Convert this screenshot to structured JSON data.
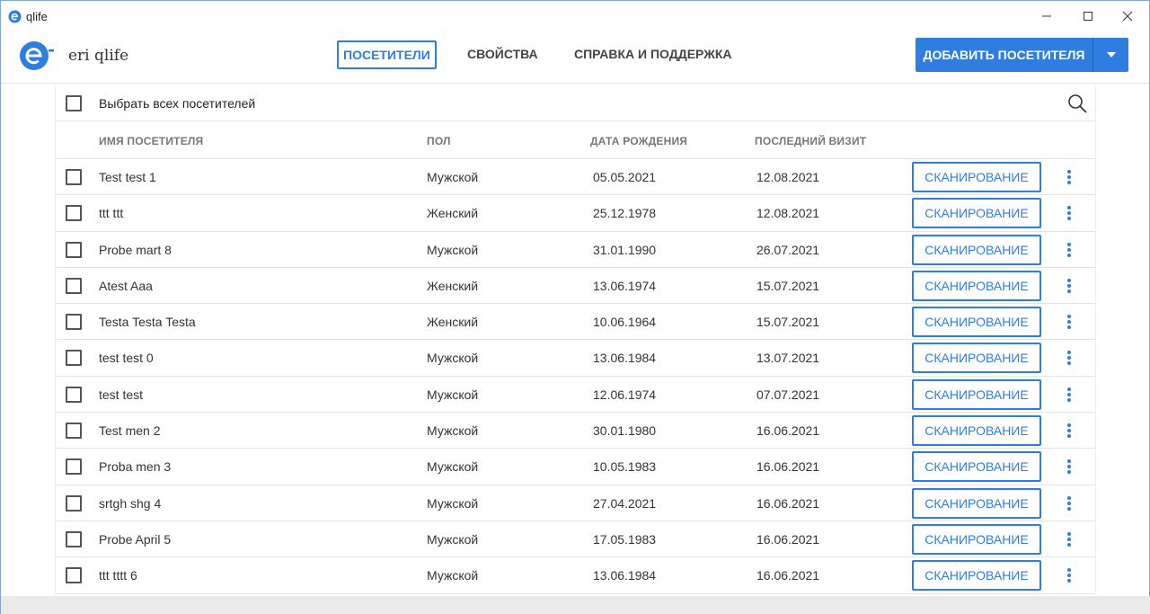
{
  "window": {
    "title": "qlife",
    "minimize_icon": "minimize-icon",
    "maximize_icon": "maximize-icon",
    "close_icon": "close-icon"
  },
  "header": {
    "brand": "eri qlife",
    "tabs": [
      {
        "label": "ПОСЕТИТЕЛИ",
        "active": true
      },
      {
        "label": "СВОЙСТВА",
        "active": false
      },
      {
        "label": "СПРАВКА И ПОДДЕРЖКА",
        "active": false
      }
    ],
    "add_button": "ДОБАВИТЬ ПОСЕТИТЕЛЯ"
  },
  "colors": {
    "accent": "#2d7ee0",
    "text": "#333333",
    "header_text": "#777777"
  },
  "table": {
    "select_all_label": "Выбрать всех посетителей",
    "columns": [
      "ИМЯ ПОСЕТИТЕЛЯ",
      "ПОЛ",
      "ДАТА РОЖДЕНИЯ",
      "ПОСЛЕДНИЙ ВИЗИТ"
    ],
    "scan_label": "СКАНИРОВАНИЕ",
    "rows": [
      {
        "name": "Test test 1",
        "sex": "Мужской",
        "dob": "05.05.2021",
        "last": "12.08.2021"
      },
      {
        "name": "ttt ttt",
        "sex": "Женский",
        "dob": "25.12.1978",
        "last": "12.08.2021"
      },
      {
        "name": "Probe mart 8",
        "sex": "Мужской",
        "dob": "31.01.1990",
        "last": "26.07.2021"
      },
      {
        "name": "Atest Aaa",
        "sex": "Женский",
        "dob": "13.06.1974",
        "last": "15.07.2021"
      },
      {
        "name": "Testa Testa Testa",
        "sex": "Женский",
        "dob": "10.06.1964",
        "last": "15.07.2021"
      },
      {
        "name": "test test 0",
        "sex": "Мужской",
        "dob": "13.06.1984",
        "last": "13.07.2021"
      },
      {
        "name": "test test",
        "sex": "Мужской",
        "dob": "12.06.1974",
        "last": "07.07.2021"
      },
      {
        "name": "Test men 2",
        "sex": "Мужской",
        "dob": "30.01.1980",
        "last": "16.06.2021"
      },
      {
        "name": "Proba men 3",
        "sex": "Мужской",
        "dob": "10.05.1983",
        "last": "16.06.2021"
      },
      {
        "name": "srtgh shg 4",
        "sex": "Мужской",
        "dob": "27.04.2021",
        "last": "16.06.2021"
      },
      {
        "name": "Probe April 5",
        "sex": "Мужской",
        "dob": "17.05.1983",
        "last": "16.06.2021"
      },
      {
        "name": "ttt tttt 6",
        "sex": "Мужской",
        "dob": "13.06.1984",
        "last": "16.06.2021"
      }
    ]
  }
}
